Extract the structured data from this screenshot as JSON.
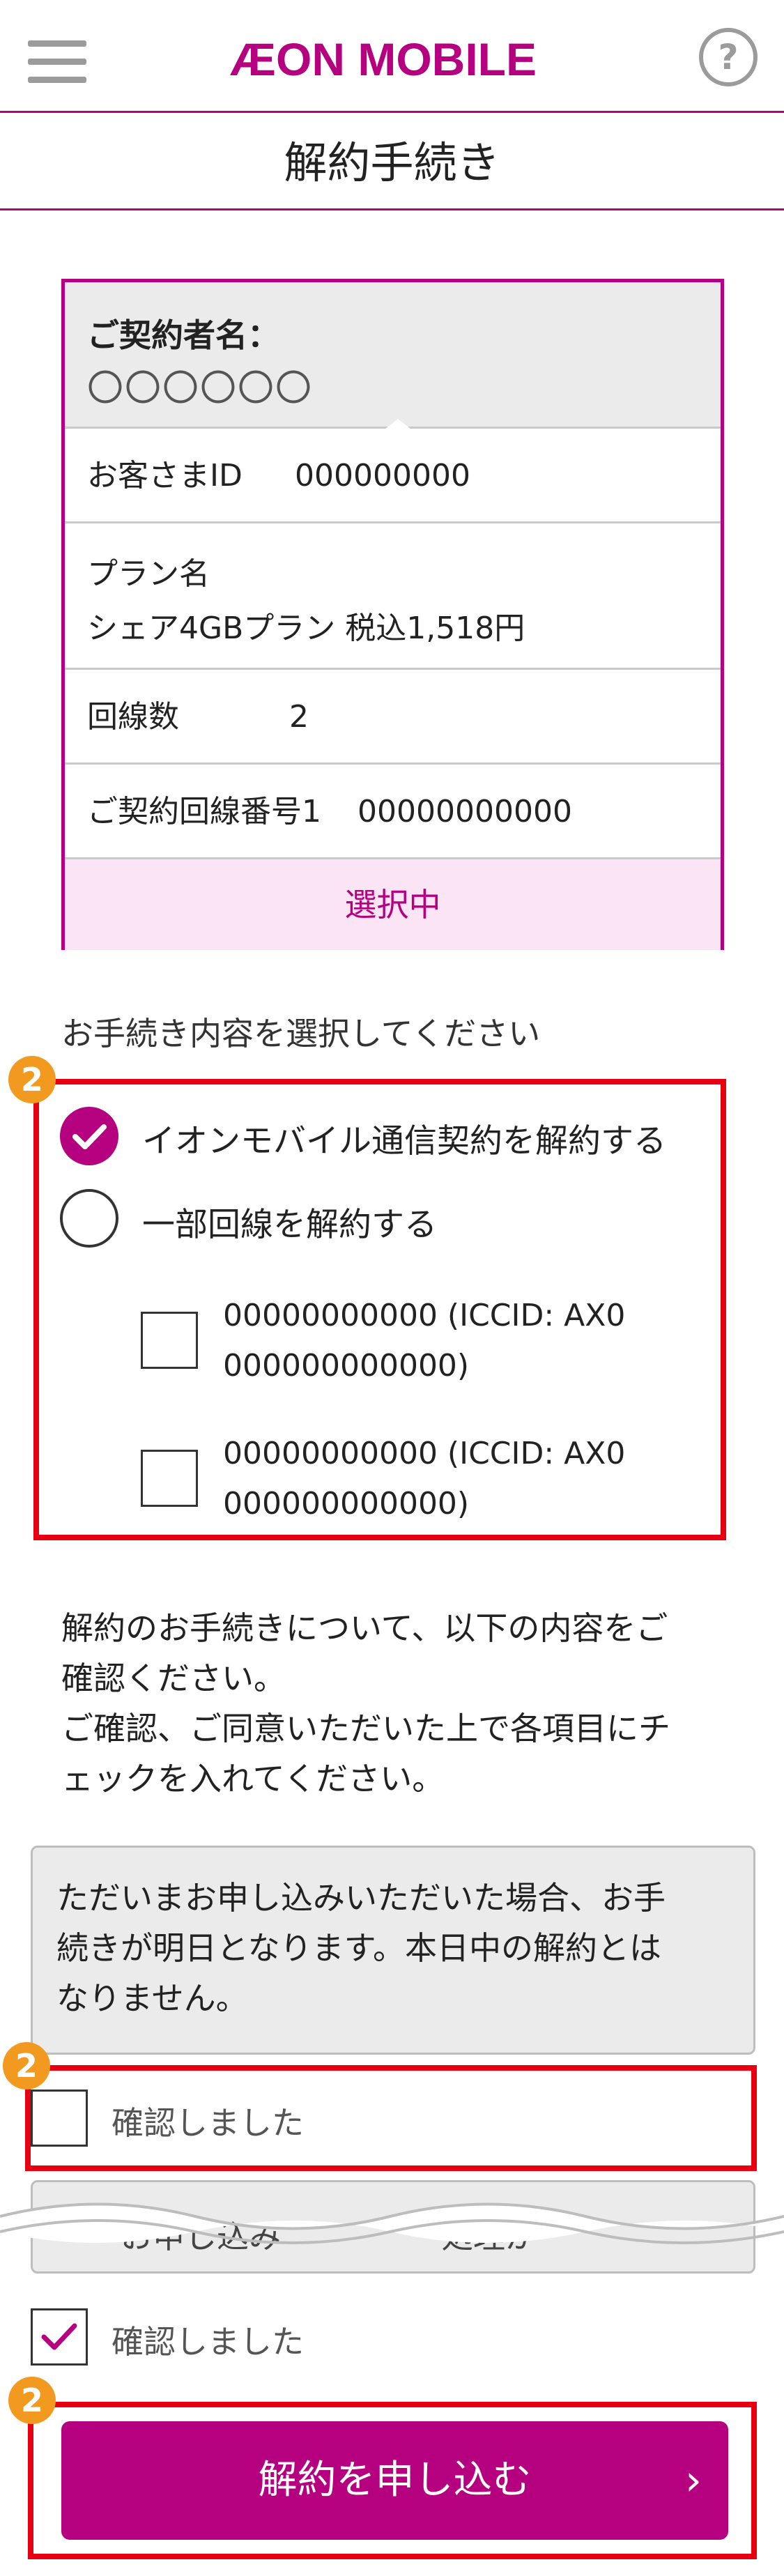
{
  "header": {
    "logo_text": "ÆON MOBILE",
    "help_glyph": "?"
  },
  "page_title": "解約手続き",
  "contract": {
    "name_label": "ご契約者名：",
    "name_value": "〇〇〇〇〇〇",
    "id_label": "お客さまID",
    "id_value": "000000000",
    "plan_label": "プラン名",
    "plan_value": "シェア4GBプラン 税込1,518円",
    "lines_label": "回線数",
    "lines_value": "2",
    "number_label": "ご契約回線番号1",
    "number_value": "00000000000",
    "selected_label": "選択中"
  },
  "procedure": {
    "prompt": "お手続き内容を選択してください",
    "badge": "2",
    "options": [
      {
        "label": "イオンモバイル通信契約を解約する",
        "selected": true
      },
      {
        "label": "一部回線を解約する",
        "selected": false
      }
    ],
    "lines": [
      {
        "line1": "00000000000 (ICCID: AX0",
        "line2": "000000000000)"
      },
      {
        "line1": "00000000000 (ICCID: AX0",
        "line2": "000000000000)"
      }
    ]
  },
  "notice": {
    "line1": "解約のお手続きについて、以下の内容をご",
    "line2": "確認ください。",
    "line3": "ご確認、ご同意いただいた上で各項目にチ",
    "line4": "ェックを入れてください。"
  },
  "terms": {
    "box1_line1": "ただいまお申し込みいただいた場合、お手",
    "box1_line2": "続きが明日となります。本日中の解約とは",
    "box1_line3": "なりません。",
    "confirm1": "確認しました",
    "box2_text": "　　お申し込み　　　　　処理が　",
    "confirm2": "確認しました"
  },
  "submit": {
    "label": "解約を申し込む",
    "chevron": "›"
  },
  "colors": {
    "brand": "#b5007f",
    "highlight": "#e60012",
    "badge": "#f29a1f"
  }
}
